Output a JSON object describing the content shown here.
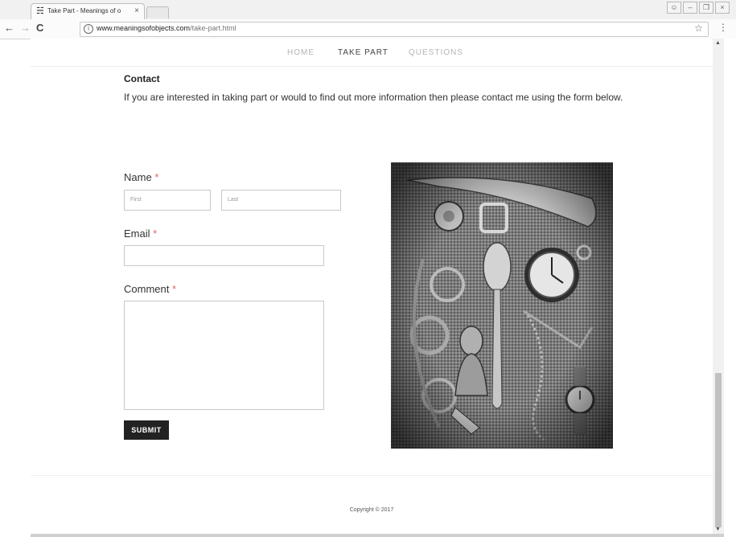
{
  "browser": {
    "tab_title": "Take Part - Meanings of o",
    "url_domain": "www.meaningsofobjects.com",
    "url_path": "/take-part.html"
  },
  "nav": {
    "items": [
      "HOME",
      "TAKE PART",
      "QUESTIONS"
    ]
  },
  "contact": {
    "heading": "Contact",
    "text": "If you are interested in taking part or would to find out more information then please contact me using the form below."
  },
  "form": {
    "name_label": "Name",
    "first_placeholder": "First",
    "last_placeholder": "Last",
    "email_label": "Email",
    "comment_label": "Comment",
    "required_marker": "*",
    "submit_label": "SUBMIT"
  },
  "footer": {
    "copyright": "Copyright © 2017"
  }
}
